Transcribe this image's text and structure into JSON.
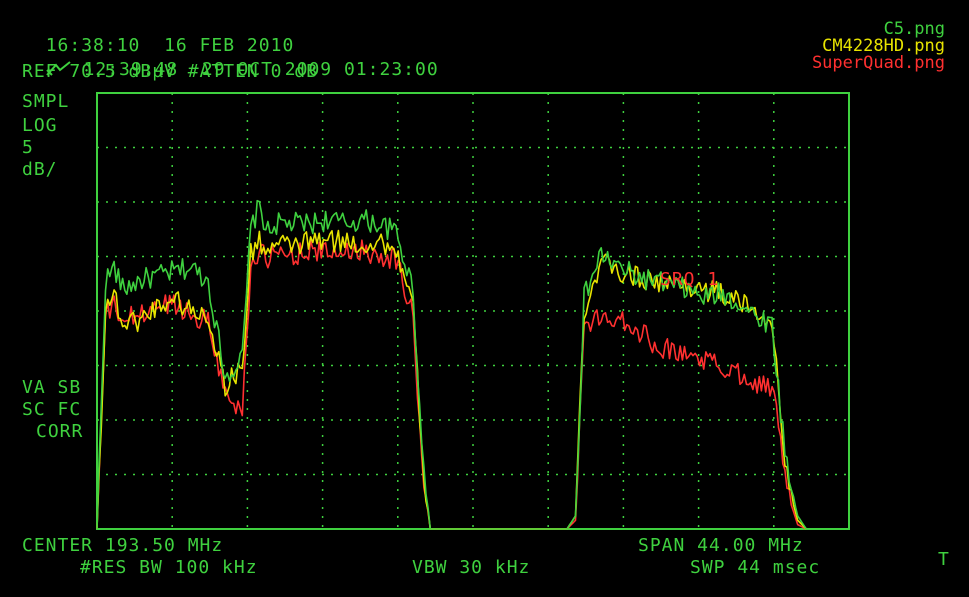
{
  "header": {
    "line1_time": "16:38:10",
    "line1_date": "16 FEB 2010",
    "line2_icon": "stored-trace-icon",
    "line2_time": "12:39:48",
    "line2_date": "29 OCT 2009 01:23:00",
    "ref": "REF 70.5 dBµV #ATTEN 0 dB"
  },
  "side_labels": {
    "mode": "SMPL",
    "scale_type": "LOG",
    "scale_value": "5",
    "scale_unit": "dB/",
    "va_sb": "VA SB",
    "sc_fc": "SC FC",
    "corr": "CORR"
  },
  "marker_label": "SRQ 1",
  "footer": {
    "center": "CENTER 193.50 MHz",
    "span": "SPAN 44.00 MHz",
    "res_bw": "#RES BW 100 kHz",
    "vbw": "VBW 30 kHz",
    "swp": "SWP 44 msec",
    "corner": "T"
  },
  "colors": {
    "grid": "#3fd13f",
    "green": "#3fd13f",
    "yellow": "#e8e400",
    "red": "#ff3030"
  },
  "chart_data": {
    "type": "line",
    "title": "",
    "xlabel": "",
    "ylabel": "",
    "x_unit": "MHz",
    "y_unit": "dBµV",
    "xlim": [
      171.5,
      215.5
    ],
    "ylim": [
      20.5,
      70.5
    ],
    "grid": true,
    "legend_position": "top-right",
    "series": [
      {
        "name": "C5.png",
        "color": "#3fd13f",
        "x": [
          171.5,
          172.0,
          172.5,
          173.0,
          174.0,
          175.0,
          176.0,
          177.0,
          178.0,
          179.0,
          180.0,
          180.5,
          181.0,
          181.5,
          182.0,
          183.0,
          184.0,
          185.0,
          186.0,
          187.0,
          188.0,
          189.0,
          190.0,
          190.5,
          191.0,
          191.5,
          199.0,
          199.5,
          200.0,
          201.0,
          202.0,
          203.0,
          204.0,
          205.0,
          206.0,
          207.0,
          208.0,
          209.0,
          210.0,
          211.0,
          211.5,
          212.0,
          212.5,
          213.0
        ],
        "y": [
          20.5,
          49.0,
          50.5,
          48.0,
          49.0,
          49.5,
          50.0,
          50.5,
          49.0,
          38.0,
          40.0,
          55.0,
          57.5,
          54.5,
          55.5,
          55.5,
          55.5,
          56.0,
          55.5,
          56.0,
          55.5,
          54.5,
          48.0,
          30.0,
          20.5,
          20.5,
          20.5,
          22.0,
          47.0,
          52.0,
          50.5,
          49.5,
          49.0,
          48.5,
          48.0,
          47.0,
          47.5,
          46.5,
          45.0,
          44.0,
          34.0,
          26.0,
          22.0,
          20.5
        ]
      },
      {
        "name": "CM4228HD.png",
        "color": "#e8e400",
        "x": [
          171.5,
          172.0,
          172.5,
          173.0,
          174.0,
          175.0,
          176.0,
          177.0,
          178.0,
          179.0,
          180.0,
          180.5,
          181.0,
          181.5,
          182.0,
          183.0,
          184.0,
          185.0,
          186.0,
          187.0,
          188.0,
          189.0,
          190.0,
          190.5,
          191.0,
          191.5,
          199.0,
          199.5,
          200.0,
          201.0,
          202.0,
          203.0,
          204.0,
          205.0,
          206.0,
          207.0,
          208.0,
          209.0,
          210.0,
          211.0,
          211.5,
          212.0,
          212.5,
          213.0
        ],
        "y": [
          20.5,
          46.0,
          47.5,
          44.0,
          44.5,
          46.0,
          47.0,
          45.5,
          45.0,
          37.0,
          39.0,
          52.0,
          53.5,
          52.5,
          53.0,
          53.0,
          53.5,
          53.5,
          53.5,
          53.0,
          53.5,
          52.5,
          46.0,
          29.0,
          20.5,
          20.5,
          20.5,
          22.0,
          45.5,
          51.0,
          50.0,
          49.5,
          49.0,
          48.5,
          48.5,
          48.0,
          47.5,
          46.5,
          45.5,
          44.5,
          33.0,
          25.0,
          21.5,
          20.5
        ]
      },
      {
        "name": "SuperQuad.png",
        "color": "#ff3030",
        "x": [
          171.5,
          172.0,
          172.5,
          173.0,
          174.0,
          175.0,
          176.0,
          177.0,
          178.0,
          179.0,
          180.0,
          180.5,
          181.0,
          181.5,
          182.0,
          183.0,
          184.0,
          185.0,
          186.0,
          187.0,
          188.0,
          189.0,
          190.0,
          190.5,
          191.0,
          191.5,
          199.0,
          199.5,
          200.0,
          201.0,
          202.0,
          203.0,
          204.0,
          205.0,
          206.0,
          207.0,
          208.0,
          209.0,
          210.0,
          211.0,
          211.5,
          212.0,
          212.5,
          213.0
        ],
        "y": [
          20.5,
          45.0,
          46.0,
          44.5,
          45.0,
          46.0,
          46.5,
          45.0,
          44.5,
          36.0,
          34.0,
          51.0,
          52.0,
          51.5,
          52.0,
          52.0,
          52.5,
          52.0,
          52.5,
          52.5,
          52.0,
          51.5,
          45.0,
          28.0,
          20.5,
          20.5,
          20.5,
          21.5,
          44.0,
          44.5,
          45.0,
          43.5,
          42.0,
          41.0,
          40.5,
          40.0,
          39.0,
          38.5,
          37.5,
          36.5,
          31.0,
          24.0,
          21.0,
          20.5
        ]
      }
    ]
  }
}
